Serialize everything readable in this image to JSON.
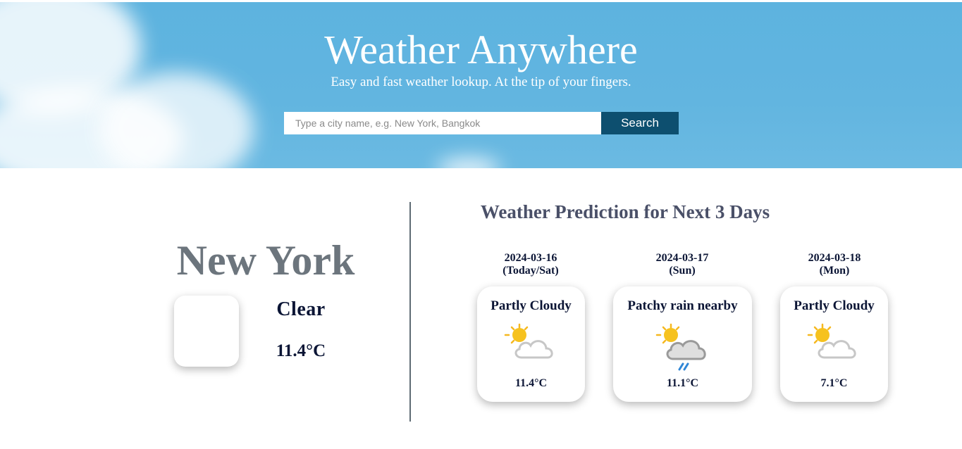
{
  "header": {
    "title": "Weather Anywhere",
    "subtitle": "Easy and fast weather lookup. At the tip of your fingers."
  },
  "search": {
    "placeholder": "Type a city name, e.g. New York, Bangkok",
    "value": "",
    "button_label": "Search"
  },
  "current": {
    "city": "New York",
    "condition": "Clear",
    "temperature": "11.4°C",
    "icon": "moon-icon"
  },
  "forecast": {
    "title": "Weather Prediction for Next 3 Days",
    "days": [
      {
        "date": "2024-03-16",
        "weekday": "(Today/Sat)",
        "condition": "Partly Cloudy",
        "temperature": "11.4°C",
        "icon": "partly-cloudy-icon"
      },
      {
        "date": "2024-03-17",
        "weekday": "(Sun)",
        "condition": "Patchy rain nearby",
        "temperature": "11.1°C",
        "icon": "patchy-rain-icon"
      },
      {
        "date": "2024-03-18",
        "weekday": "(Mon)",
        "condition": "Partly Cloudy",
        "temperature": "7.1°C",
        "icon": "partly-cloudy-icon"
      }
    ]
  },
  "colors": {
    "sky": "#5db3df",
    "search_button": "#0d4f6f",
    "city_text": "#6c757d",
    "dark_text": "#0b1535",
    "moon_icon": "#1a73c7"
  }
}
